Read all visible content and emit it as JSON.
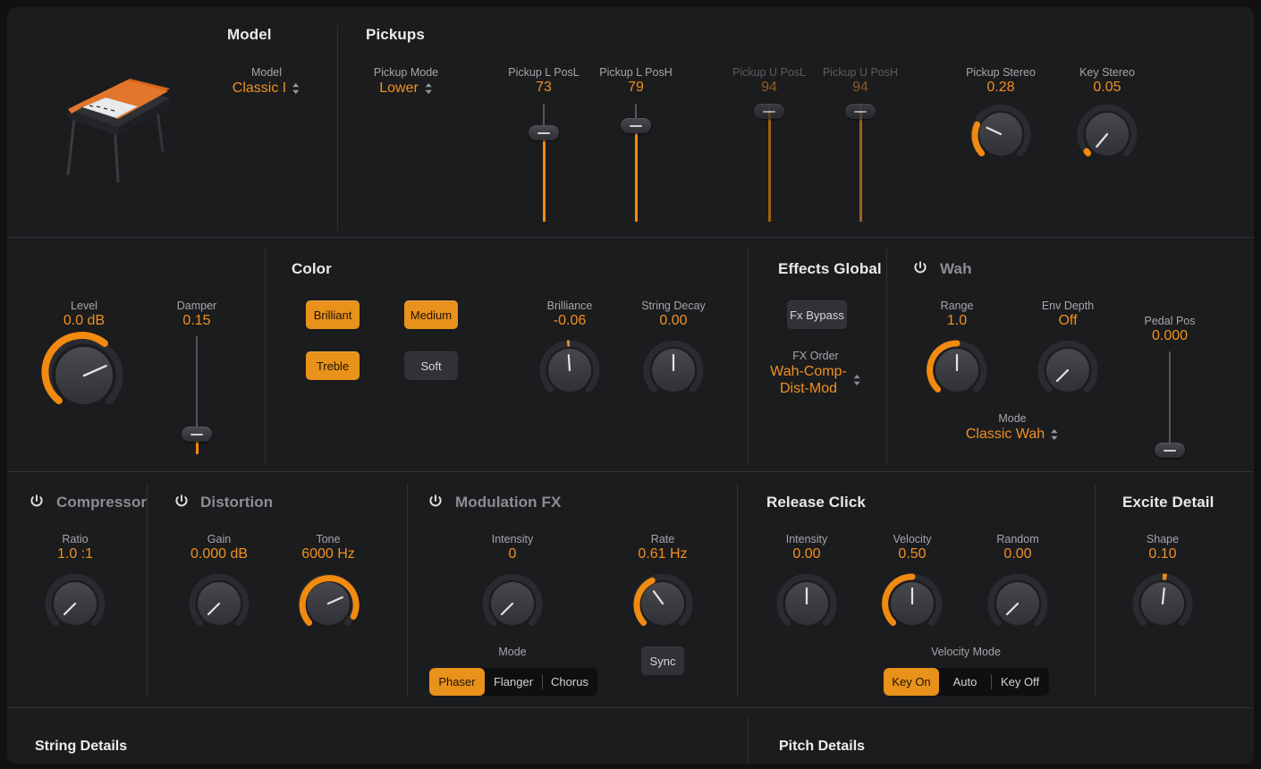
{
  "accent": "#e8911b",
  "value_color": "#f09020",
  "label_color": "#a6a6aa",
  "panel_bg": "#1b1c1e",
  "sections": {
    "model": {
      "title": "Model"
    },
    "pickups": {
      "title": "Pickups"
    },
    "color": {
      "title": "Color"
    },
    "effects_global": {
      "title": "Effects Global"
    },
    "wah": {
      "title": "Wah",
      "enabled": false
    },
    "compressor": {
      "title": "Compressor",
      "enabled": false
    },
    "distortion": {
      "title": "Distortion",
      "enabled": false
    },
    "modulation_fx": {
      "title": "Modulation FX",
      "enabled": false
    },
    "release_click": {
      "title": "Release Click"
    },
    "excite_detail": {
      "title": "Excite Detail"
    },
    "string_details": {
      "title": "String Details"
    },
    "pitch_details": {
      "title": "Pitch Details"
    }
  },
  "model": {
    "param_label": "Model",
    "value": "Classic I",
    "instrument_icon": "electric-piano-on-stand"
  },
  "pickups": {
    "mode_label": "Pickup Mode",
    "mode_value": "Lower",
    "sliders": [
      {
        "label": "Pickup L PosL",
        "value": "73",
        "pos": 0.73,
        "enabled": true
      },
      {
        "label": "Pickup L PosH",
        "value": "79",
        "pos": 0.79,
        "enabled": true
      },
      {
        "label": "Pickup U PosL",
        "value": "94",
        "pos": 0.94,
        "enabled": false
      },
      {
        "label": "Pickup U PosH",
        "value": "94",
        "pos": 0.94,
        "enabled": false
      }
    ],
    "knobs": [
      {
        "label": "Pickup Stereo",
        "value": "0.28",
        "norm": 0.28
      },
      {
        "label": "Key Stereo",
        "value": "0.05",
        "norm": 0.05
      }
    ]
  },
  "main": {
    "level": {
      "label": "Level",
      "value": "0.0 dB",
      "norm": 0.78
    },
    "damper": {
      "label": "Damper",
      "value": "0.15",
      "pos": 0.15
    }
  },
  "color": {
    "buttons": [
      {
        "label": "Brilliant",
        "on": true
      },
      {
        "label": "Medium",
        "on": true
      },
      {
        "label": "Treble",
        "on": true
      },
      {
        "label": "Soft",
        "on": false
      }
    ],
    "knobs": [
      {
        "label": "Brilliance",
        "value": "-0.06",
        "norm": 0.47,
        "bipolar": true
      },
      {
        "label": "String Decay",
        "value": "0.00",
        "norm": 0.5,
        "bipolar": true
      }
    ]
  },
  "effects_global": {
    "fx_bypass_label": "Fx Bypass",
    "fx_bypass_on": false,
    "fx_order_label": "FX Order",
    "fx_order_value_line1": "Wah-Comp-",
    "fx_order_value_line2": "Dist-Mod"
  },
  "wah": {
    "range": {
      "label": "Range",
      "value": "1.0",
      "norm": 0.5
    },
    "env_depth": {
      "label": "Env Depth",
      "value": "Off",
      "norm": 0.0
    },
    "pedal_pos": {
      "label": "Pedal Pos",
      "value": "0.000",
      "pos": 0.0
    },
    "mode_label": "Mode",
    "mode_value": "Classic Wah"
  },
  "compressor": {
    "ratio": {
      "label": "Ratio",
      "value": "1.0 :1",
      "norm": 0.0
    }
  },
  "distortion": {
    "gain": {
      "label": "Gain",
      "value": "0.000 dB",
      "norm": 0.0
    },
    "tone": {
      "label": "Tone",
      "value": "6000 Hz",
      "norm": 0.82
    }
  },
  "modulation_fx": {
    "intensity": {
      "label": "Intensity",
      "value": "0",
      "norm": 0.0
    },
    "rate": {
      "label": "Rate",
      "value": "0.61 Hz",
      "norm": 0.31
    },
    "mode_label": "Mode",
    "mode_options": [
      {
        "label": "Phaser",
        "on": true
      },
      {
        "label": "Flanger",
        "on": false
      },
      {
        "label": "Chorus",
        "on": false
      }
    ],
    "sync_label": "Sync",
    "sync_on": false
  },
  "release_click": {
    "intensity": {
      "label": "Intensity",
      "value": "0.00",
      "norm": 0.5,
      "bipolar": true
    },
    "velocity": {
      "label": "Velocity",
      "value": "0.50",
      "norm": 0.5
    },
    "random": {
      "label": "Random",
      "value": "0.00",
      "norm": 0.0
    },
    "velocity_mode_label": "Velocity Mode",
    "velocity_mode_options": [
      {
        "label": "Key On",
        "on": true
      },
      {
        "label": "Auto",
        "on": false
      },
      {
        "label": "Key Off",
        "on": false
      }
    ]
  },
  "excite_detail": {
    "shape": {
      "label": "Shape",
      "value": "0.10",
      "norm": 0.55,
      "bipolar": true
    }
  }
}
